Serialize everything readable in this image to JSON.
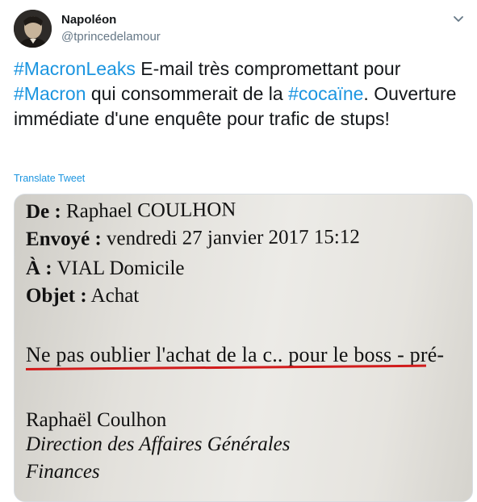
{
  "author": {
    "name": "Napoléon",
    "handle": "@tprincedelamour"
  },
  "tweet": {
    "tag1": "#MacronLeaks",
    "text1": " E-mail très compromettant pour ",
    "tag2": "#Macron",
    "text2": " qui consommerait de la ",
    "tag3": "#cocaïne",
    "text3": ". Ouverture immédiate d'une enquête pour trafic de stups!"
  },
  "translate_label": "Translate Tweet",
  "document": {
    "from_label": "De :",
    "from_value": " Raphael COULHON",
    "sent_label": "Envoyé :",
    "sent_value": " vendredi 27 janvier 2017 15:12",
    "to_label": "À :",
    "to_value": " VIAL Domicile",
    "subject_label": "Objet :",
    "subject_value": " Achat",
    "body": "Ne pas oublier l'achat de la c.. pour le boss - pré-",
    "signature_name": "Raphaël Coulhon",
    "signature_dept": "Direction des Affaires Générales",
    "signature_dept2": "Finances"
  },
  "colors": {
    "link": "#1b95e0",
    "handle": "#657786",
    "underline": "#d11c1c"
  },
  "icons": {
    "caret": "chevron-down-icon"
  }
}
